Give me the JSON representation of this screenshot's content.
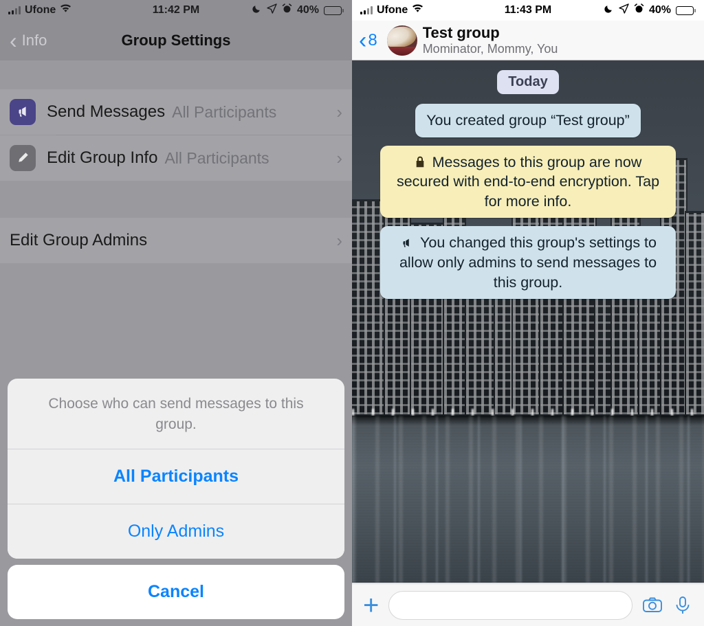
{
  "left": {
    "status_bar": {
      "carrier": "Ufone",
      "time": "11:42 PM",
      "battery_percent": "40%"
    },
    "nav": {
      "back_label": "Info",
      "title": "Group Settings"
    },
    "rows": [
      {
        "icon": "megaphone-icon",
        "label": "Send Messages",
        "value": "All Participants",
        "icon_color": "#4a4488"
      },
      {
        "icon": "pencil-icon",
        "label": "Edit Group Info",
        "value": "All Participants",
        "icon_color": "#6e6e73"
      }
    ],
    "admins_row": {
      "label": "Edit Group Admins"
    },
    "action_sheet": {
      "title": "Choose who can send messages to this group.",
      "options": [
        {
          "label": "All Participants",
          "emphasis": "bold"
        },
        {
          "label": "Only Admins",
          "emphasis": "normal"
        }
      ],
      "cancel_label": "Cancel"
    }
  },
  "right": {
    "status_bar": {
      "carrier": "Ufone",
      "time": "11:43 PM",
      "battery_percent": "40%"
    },
    "nav": {
      "back_count": "8",
      "title": "Test group",
      "subtitle": "Mominator, Mommy, You",
      "avatar": "cat-photo-avatar"
    },
    "chat": {
      "date_pill": "Today",
      "messages": [
        {
          "kind": "system-info",
          "text": "You created group “Test group”",
          "icon": ""
        },
        {
          "kind": "encryption-notice",
          "text": "Messages to this group are now secured with end-to-end encryption. Tap for more info.",
          "icon": "🔒"
        },
        {
          "kind": "system-info",
          "text": "You changed this group's settings to allow only admins to send messages to this group.",
          "icon": "📢"
        }
      ]
    },
    "composer": {
      "attach_icon": "plus-icon",
      "input_value": "",
      "input_placeholder": "",
      "camera_icon": "camera-icon",
      "mic_icon": "microphone-icon"
    }
  },
  "colors": {
    "accent_blue": "#0a84ff",
    "encryption_yellow": "#f7eeb9",
    "info_blue": "#cfe2ec",
    "dim_overlay": "#8e8e93"
  }
}
